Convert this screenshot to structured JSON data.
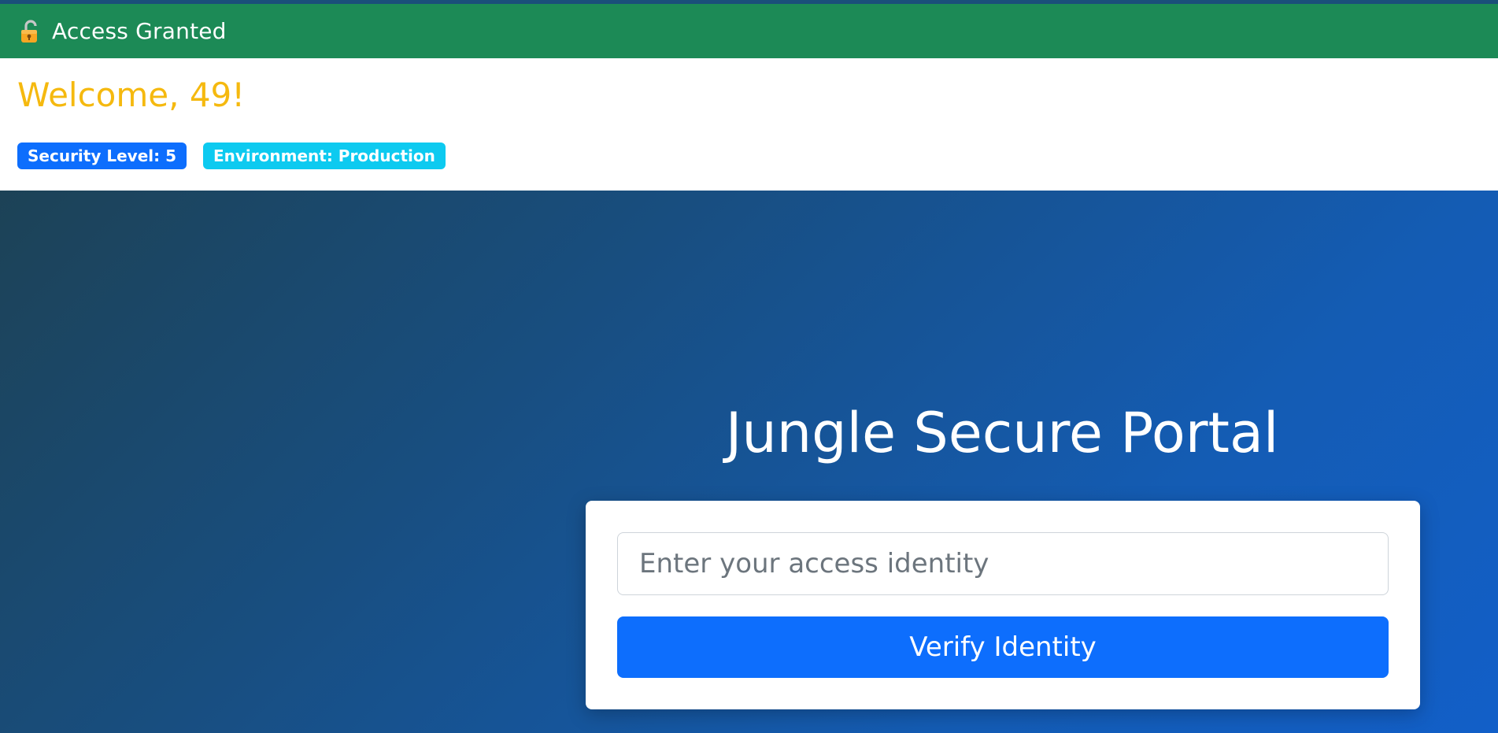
{
  "header": {
    "lock_icon": "unlocked-padlock-icon",
    "title": "Access Granted",
    "background_color": "#1c8a56"
  },
  "welcome": {
    "greeting": "Welcome, 49!",
    "greeting_color": "#f5b90f",
    "badges": [
      {
        "label": "Security Level: 5",
        "color": "#0d6efd"
      },
      {
        "label": "Environment: Production",
        "color": "#0dcaf0"
      }
    ]
  },
  "portal": {
    "title": "Jungle Secure Portal",
    "input": {
      "value": "",
      "placeholder": "Enter your access identity"
    },
    "submit_label": "Verify Identity",
    "accent_color": "#0d6efd"
  }
}
